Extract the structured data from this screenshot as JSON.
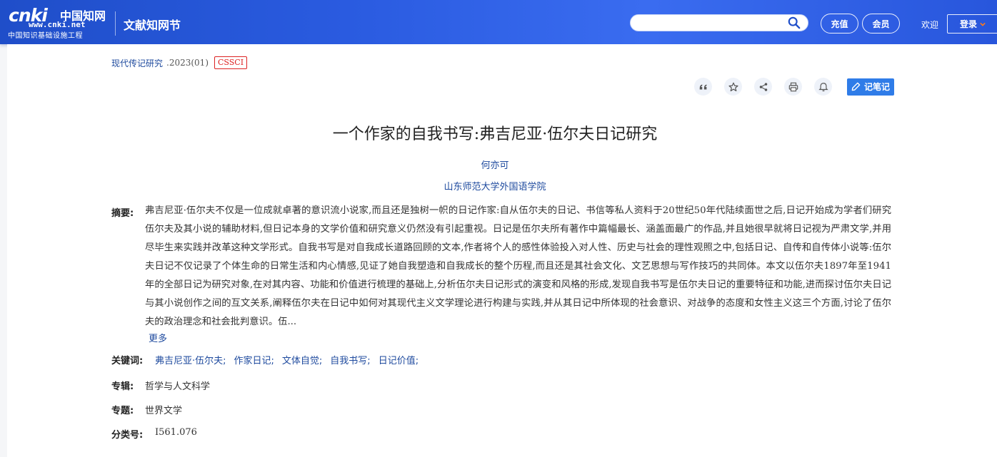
{
  "header": {
    "logo_cnki": "cnki",
    "logo_cn": "中国知网",
    "logo_url": "www.cnki.net",
    "logo_sub": "中国知识基础设施工程",
    "site_title": "文献知网节",
    "search_placeholder": "",
    "recharge_label": "充值",
    "member_label": "会员",
    "welcome": "欢迎",
    "login_label": "登录",
    "colors": {
      "bar_start": "#1f4ec9",
      "bar_end": "#3a6cf0"
    }
  },
  "source": {
    "journal": "现代传记研究",
    "issue": ".2023(01)",
    "badge": "CSSCI"
  },
  "tools": {
    "icons": [
      "quote-icon",
      "star-icon",
      "share-icon",
      "print-icon",
      "bell-icon"
    ],
    "note_label": "记笔记"
  },
  "article": {
    "title": "一个作家的自我书写:弗吉尼亚·伍尔夫日记研究",
    "author": "何亦可",
    "organization": "山东师范大学外国语学院",
    "abstract_label": "摘要:",
    "abstract": "弗吉尼亚·伍尔夫不仅是一位成就卓著的意识流小说家,而且还是独树一帜的日记作家:自从伍尔夫的日记、书信等私人资料于20世纪50年代陆续面世之后,日记开始成为学者们研究伍尔夫及其小说的辅助材料,但日记本身的文学价值和研究意义仍然没有引起重视。日记是伍尔夫所有著作中篇幅最长、涵盖面最广的作品,并且她很早就将日记视为严肃文学,并用尽毕生来实践并改革这种文学形式。自我书写是对自我成长道路回顾的文本,作者将个人的感性体验投入对人性、历史与社会的理性观照之中,包括日记、自传和自传体小说等:伍尔夫日记不仅记录了个体生命的日常生活和内心情感,见证了她自我塑造和自我成长的整个历程,而且还是其社会文化、文艺思想与写作技巧的共同体。本文以伍尔夫1897年至1941年的全部日记为研究对象,在对其内容、功能和价值进行梳理的基础上,分析伍尔夫日记形式的演变和风格的形成,发现自我书写是伍尔夫日记的重要特征和功能,进而探讨伍尔夫日记与其小说创作之间的互文关系,阐释伍尔夫在日记中如何对其现代主义文学理论进行构建与实践,并从其日记中所体现的社会意识、对战争的态度和女性主义这三个方面,讨论了伍尔夫的政治理念和社会批判意识。伍...",
    "more_label": "更多",
    "keywords_label": "关键词:",
    "keywords": [
      "弗吉尼亚·伍尔夫;",
      "作家日记;",
      "文体自觉;",
      "自我书写;",
      "日记价值;"
    ],
    "album_label": "专辑:",
    "album": "哲学与人文科学",
    "topic_label": "专题:",
    "topic": "世界文学",
    "class_label": "分类号:",
    "class_no": "I561.076"
  }
}
